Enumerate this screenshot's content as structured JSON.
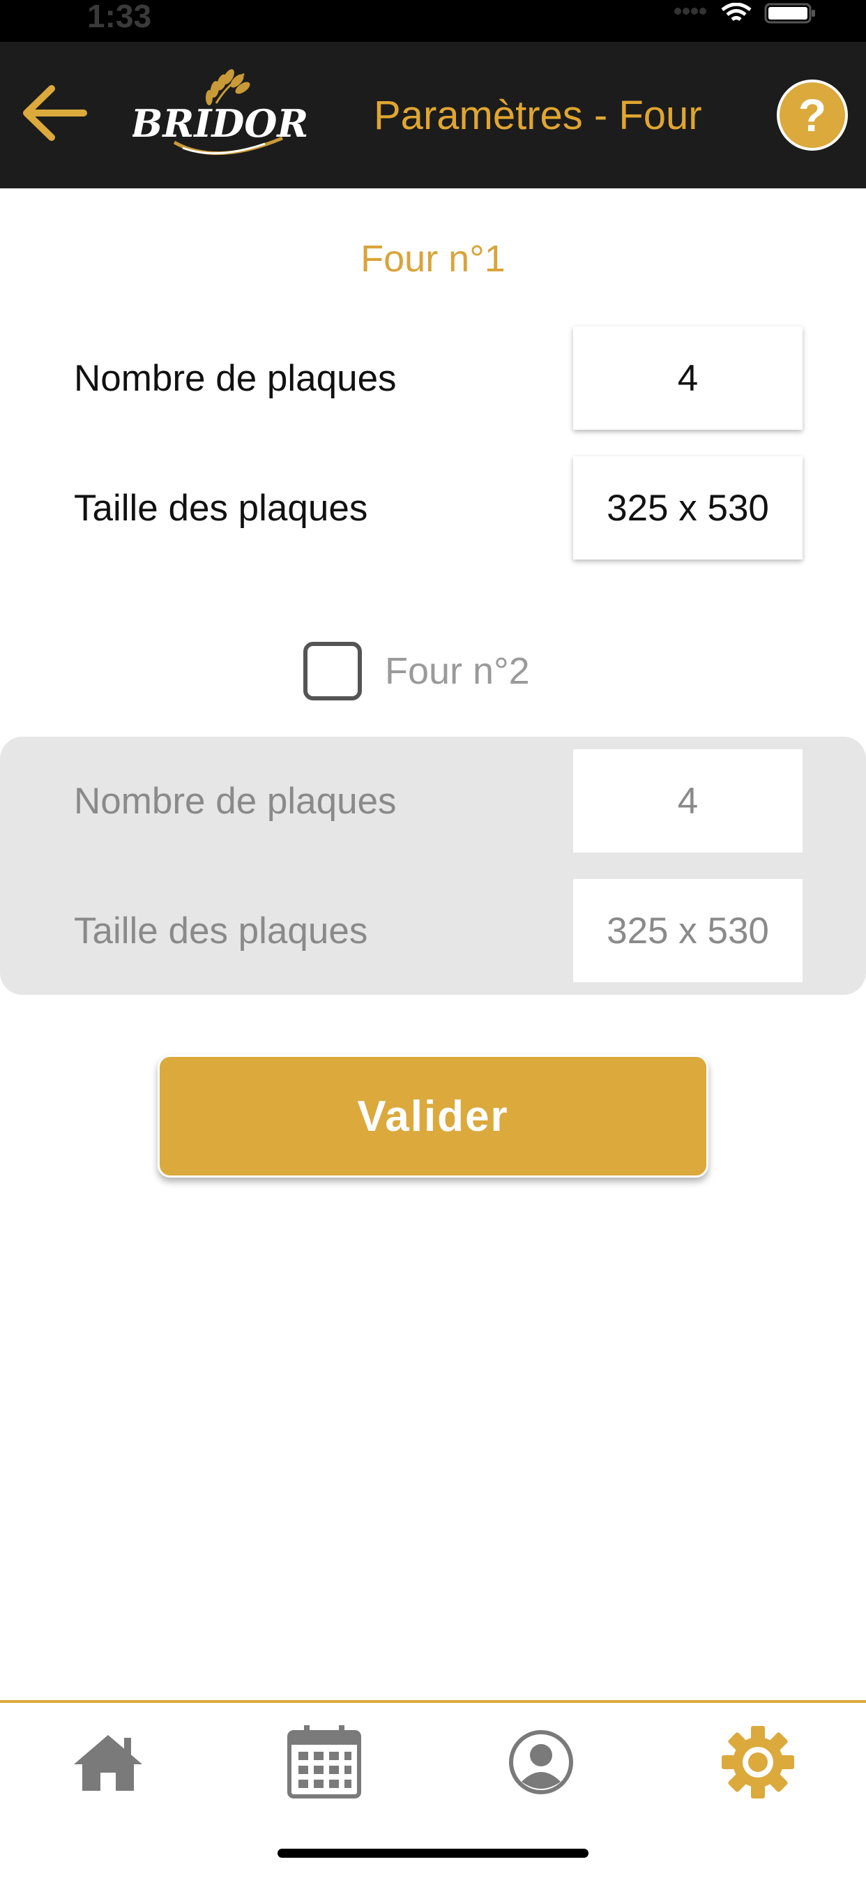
{
  "status_bar": {
    "time": "1:33"
  },
  "header": {
    "back_icon": "arrow-left-icon",
    "logo_text": "BRIDOR",
    "title": "Paramètres - Four",
    "help_label": "?"
  },
  "oven1": {
    "title": "Four n°1",
    "plates_count_label": "Nombre de plaques",
    "plates_count_value": "4",
    "plates_size_label": "Taille des plaques",
    "plates_size_value": "325 x 530"
  },
  "oven2": {
    "checkbox_label": "Four n°2",
    "checked": false,
    "plates_count_label": "Nombre de plaques",
    "plates_count_value": "4",
    "plates_size_label": "Taille des plaques",
    "plates_size_value": "325 x 530"
  },
  "submit_label": "Valider",
  "tabs": [
    {
      "icon": "home-icon",
      "active": false
    },
    {
      "icon": "calendar-icon",
      "active": false
    },
    {
      "icon": "profile-icon",
      "active": false
    },
    {
      "icon": "gear-icon",
      "active": true
    }
  ],
  "colors": {
    "accent": "#dba93c",
    "header_bg": "#1c1c1c",
    "inactive_icon": "#7a7a7a"
  }
}
